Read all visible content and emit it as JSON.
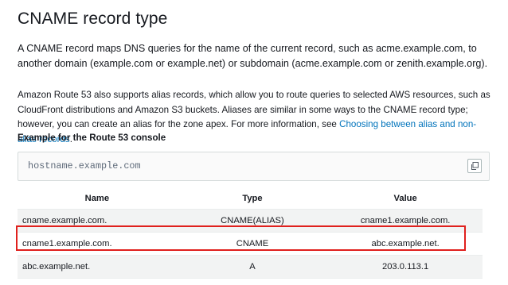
{
  "title": "CNAME record type",
  "intro": "A CNAME record maps DNS queries for the name of the current record, such as acme.example.com, to another domain (example.com or example.net) or subdomain (acme.example.com or zenith.example.org).",
  "note": {
    "text_before": "Amazon Route 53 also supports alias records, which allow you to route queries to selected AWS resources, such as CloudFront distributions and Amazon S3 buckets. Aliases are similar in some ways to the CNAME record type; however, you can create an alias for the zone apex. For more information, see ",
    "link_text": "Choosing between alias and non-alias records",
    "text_after": "."
  },
  "example": {
    "heading": "Example for the Route 53 console",
    "code": "hostname.example.com",
    "copy_icon": "copy-icon"
  },
  "table": {
    "headers": [
      "Name",
      "Type",
      "Value"
    ],
    "rows": [
      {
        "name": "cname.example.com.",
        "type": "CNAME(ALIAS)",
        "value": "cname1.example.com."
      },
      {
        "name": "cname1.example.com.",
        "type": "CNAME",
        "value": "abc.example.net."
      },
      {
        "name": "abc.example.net.",
        "type": "A",
        "value": "203.0.113.1"
      }
    ],
    "highlighted_row": 1
  },
  "colors": {
    "link": "#0073bb",
    "highlight_border": "#e0201d",
    "row_shade": "#f2f3f3"
  }
}
